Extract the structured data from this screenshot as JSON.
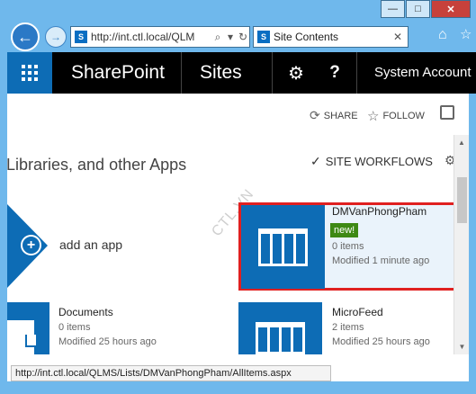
{
  "window": {
    "minimize": "—",
    "maximize": "□",
    "close": "✕"
  },
  "browser": {
    "address": "http://int.ctl.local/QLM",
    "tab_title": "Site Contents"
  },
  "suitebar": {
    "brand": "SharePoint",
    "sites": "Sites",
    "account": "System Account"
  },
  "commands": {
    "share": "SHARE",
    "follow": "FOLLOW"
  },
  "page": {
    "title": "Libraries, and other Apps",
    "workflows": "SITE WORKFLOWS",
    "watermark": "CTL.VN",
    "add_app": "add an app"
  },
  "tiles": [
    {
      "name": "DMVanPhongPham",
      "badge": "new!",
      "count": "0 items",
      "modified": "Modified 1 minute ago"
    },
    {
      "name": "Documents",
      "count": "0 items",
      "modified": "Modified 25 hours ago"
    },
    {
      "name": "MicroFeed",
      "count": "2 items",
      "modified": "Modified 25 hours ago"
    }
  ],
  "status_url": "http://int.ctl.local/QLMS/Lists/DMVanPhongPham/AllItems.aspx",
  "colors": {
    "brand_blue": "#0d6cb5",
    "selection_red": "#e02020",
    "new_badge": "#3e8914"
  }
}
